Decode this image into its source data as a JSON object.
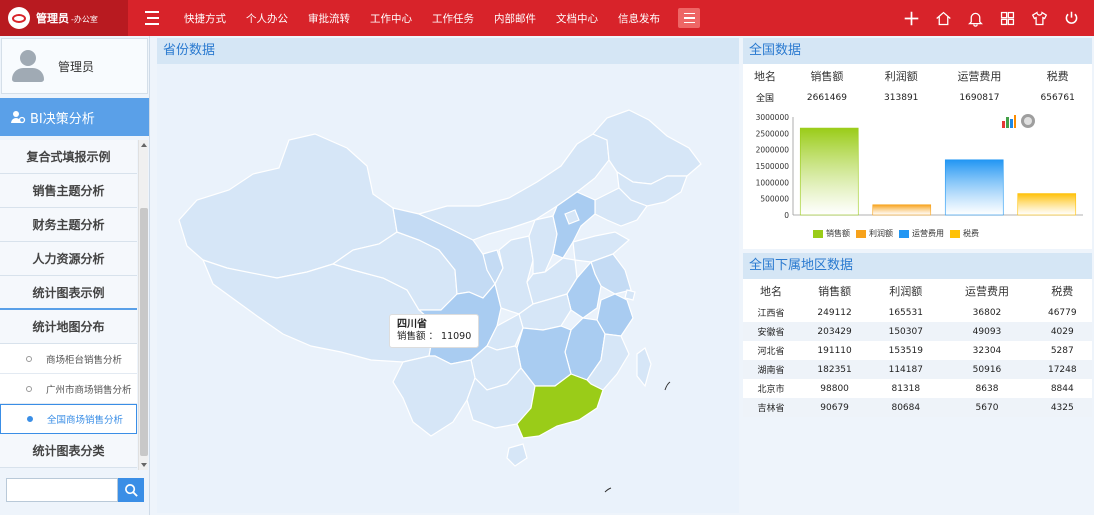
{
  "topbar": {
    "user": "管理员",
    "dept": "-办公室",
    "nav": [
      "快捷方式",
      "个人办公",
      "审批流转",
      "工作中心",
      "工作任务",
      "内部邮件",
      "文档中心",
      "信息发布"
    ],
    "icons": [
      "plus-icon",
      "home-icon",
      "bell-icon",
      "grid-icon",
      "shirt-icon",
      "power-icon"
    ]
  },
  "sidebar": {
    "user_name": "管理员",
    "section_title": "BI决策分析",
    "menu": [
      {
        "label": "复合式填报示例"
      },
      {
        "label": "销售主题分析"
      },
      {
        "label": "财务主题分析"
      },
      {
        "label": "人力资源分析"
      },
      {
        "label": "统计图表示例"
      },
      {
        "label": "统计地图分布"
      }
    ],
    "sub_items": [
      "商场柜台销售分析",
      "广州市商场销售分析",
      "全国商场销售分析"
    ],
    "last_menu": "统计图表分类",
    "search_placeholder": ""
  },
  "map_panel": {
    "title": "省份数据",
    "tooltip_province": "四川省",
    "tooltip_label": "销售额 ： 11090"
  },
  "national": {
    "title": "全国数据",
    "headers": [
      "地名",
      "销售额",
      "利润额",
      "运营费用",
      "税费"
    ],
    "row": [
      "全国",
      "2661469",
      "313891",
      "1690817",
      "656761"
    ]
  },
  "chart_data": {
    "type": "bar",
    "categories": [
      "销售额",
      "利润额",
      "运营费用",
      "税费"
    ],
    "values": [
      2661469,
      313891,
      1690817,
      656761
    ],
    "ylim": [
      0,
      3000000
    ],
    "yticks": [
      "3000000",
      "2500000",
      "2000000",
      "1500000",
      "1000000",
      "500000",
      "0"
    ],
    "colors": [
      "#9acc18",
      "#f7a21b",
      "#2196f3",
      "#ffc107"
    ],
    "legend": [
      "销售额",
      "利润额",
      "运营费用",
      "税费"
    ],
    "legend_position": "bottom",
    "grid": false
  },
  "regions": {
    "title": "全国下属地区数据",
    "headers": [
      "地名",
      "销售额",
      "利润额",
      "运营费用",
      "税费"
    ],
    "rows": [
      [
        "江西省",
        "249112",
        "165531",
        "36802",
        "46779"
      ],
      [
        "安徽省",
        "203429",
        "150307",
        "49093",
        "4029"
      ],
      [
        "河北省",
        "191110",
        "153519",
        "32304",
        "5287"
      ],
      [
        "湖南省",
        "182351",
        "114187",
        "50916",
        "17248"
      ],
      [
        "北京市",
        "98800",
        "81318",
        "8638",
        "8844"
      ],
      [
        "吉林省",
        "90679",
        "80684",
        "5670",
        "4325"
      ]
    ]
  }
}
